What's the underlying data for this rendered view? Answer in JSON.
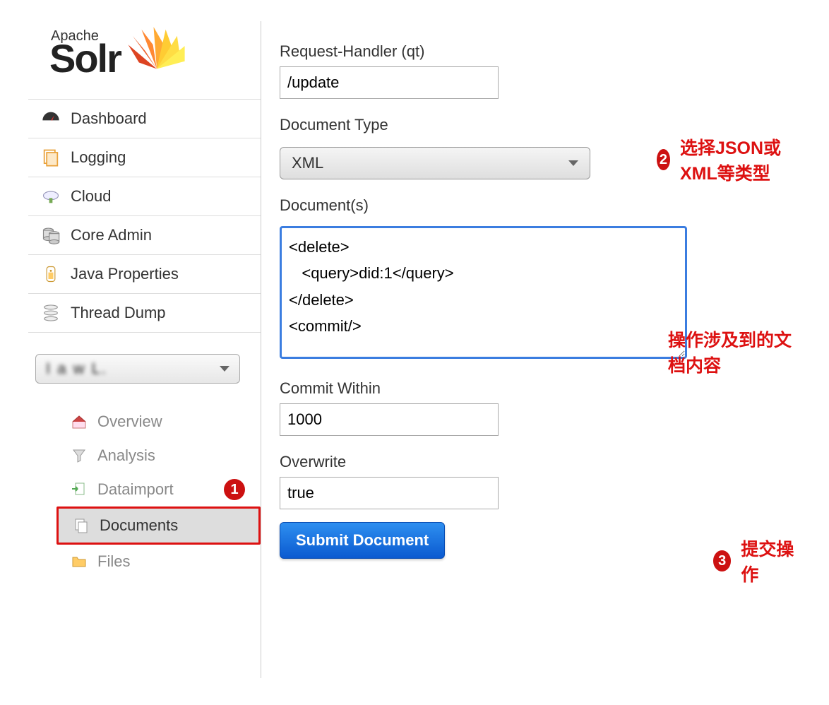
{
  "logo": {
    "apache": "Apache",
    "solr": "Solr"
  },
  "sidebar": {
    "items": [
      {
        "label": "Dashboard",
        "icon": "dashboard-icon"
      },
      {
        "label": "Logging",
        "icon": "logging-icon"
      },
      {
        "label": "Cloud",
        "icon": "cloud-icon"
      },
      {
        "label": "Core Admin",
        "icon": "coreadmin-icon"
      },
      {
        "label": "Java Properties",
        "icon": "java-icon"
      },
      {
        "label": "Thread Dump",
        "icon": "thread-icon"
      }
    ]
  },
  "subnav": {
    "items": [
      {
        "label": "Overview",
        "icon": "home-icon"
      },
      {
        "label": "Analysis",
        "icon": "funnel-icon"
      },
      {
        "label": "Dataimport",
        "icon": "import-icon"
      },
      {
        "label": "Documents",
        "icon": "documents-icon"
      },
      {
        "label": "Files",
        "icon": "folder-icon"
      }
    ]
  },
  "form": {
    "qt_label": "Request-Handler (qt)",
    "qt_value": "/update",
    "doctype_label": "Document Type",
    "doctype_value": "XML",
    "docs_label": "Document(s)",
    "docs_value": "<delete>\n   <query>did:1</query>\n</delete>\n<commit/>",
    "commit_label": "Commit Within",
    "commit_value": "1000",
    "overwrite_label": "Overwrite",
    "overwrite_value": "true",
    "submit_label": "Submit Document"
  },
  "annotations": {
    "badge1": "1",
    "badge2": "2",
    "text2": "选择JSON或XML等类型",
    "docs_text": "操作涉及到的文档内容",
    "badge3": "3",
    "text3": "提交操作"
  }
}
